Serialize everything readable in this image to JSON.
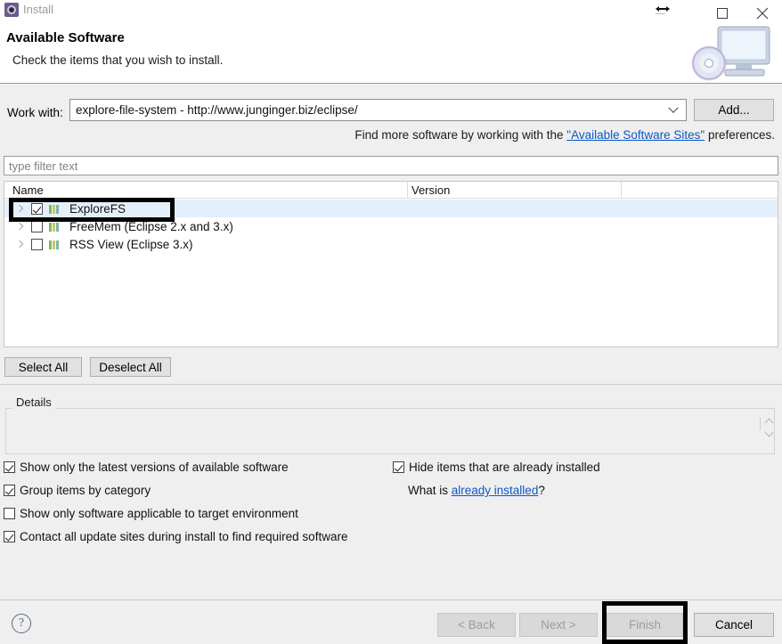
{
  "window": {
    "title": "Install",
    "icon": "install-gear-icon",
    "controls": {
      "resize": "resize-horizontal-cursor",
      "minimize": "minimize-icon",
      "maximize": "maximize-icon",
      "close": "close-icon"
    }
  },
  "header": {
    "title": "Available Software",
    "subtitle": "Check the items that you wish to install.",
    "artwork": "monitor-cd-icon"
  },
  "work_with": {
    "label": "Work with:",
    "value": "explore-file-system - http://www.junginger.biz/eclipse/",
    "dropdown_icon": "chevron-down-icon",
    "add_button": "Add..."
  },
  "find_more": {
    "prefix": "Find more software by working with the ",
    "link": "\"Available Software Sites\"",
    "suffix": " preferences."
  },
  "filter": {
    "placeholder": "type filter text",
    "value": ""
  },
  "tree": {
    "columns": [
      "Name",
      "Version"
    ],
    "rows": [
      {
        "name": "ExploreFS",
        "version": "",
        "checked": true,
        "selected": true,
        "expandable": true,
        "icon": "feature-icon"
      },
      {
        "name": "FreeMem (Eclipse 2.x and 3.x)",
        "version": "",
        "checked": false,
        "selected": false,
        "expandable": true,
        "icon": "feature-icon"
      },
      {
        "name": "RSS View (Eclipse 3.x)",
        "version": "",
        "checked": false,
        "selected": false,
        "expandable": true,
        "icon": "feature-icon"
      }
    ]
  },
  "list_buttons": {
    "select_all": "Select All",
    "deselect_all": "Deselect All"
  },
  "details": {
    "legend": "Details",
    "content": "",
    "spinner_icon": "spinner-up-down-icon"
  },
  "options": {
    "left": [
      {
        "label": "Show only the latest versions of available software",
        "checked": true
      },
      {
        "label": "Group items by category",
        "checked": true
      },
      {
        "label": "Show only software applicable to target environment",
        "checked": false
      },
      {
        "label": "Contact all update sites during install to find required software",
        "checked": true
      }
    ],
    "right": [
      {
        "label": "Hide items that are already installed",
        "checked": true
      }
    ],
    "what_is": {
      "prefix": "What is ",
      "link": "already installed",
      "suffix": "?"
    }
  },
  "footer": {
    "help_icon": "help-question-icon",
    "buttons": [
      {
        "label": "< Back",
        "disabled": true
      },
      {
        "label": "Next >",
        "disabled": true
      },
      {
        "label": "Finish",
        "disabled": true,
        "annotated": true
      },
      {
        "label": "Cancel",
        "disabled": false
      }
    ]
  },
  "annotations": {
    "explorefs_row": "highlight-box",
    "finish_button": "highlight-box"
  },
  "colors": {
    "selection": "#e3f0fc",
    "link": "#0b57c7",
    "annotation": "#000000",
    "body": "#efefef"
  }
}
